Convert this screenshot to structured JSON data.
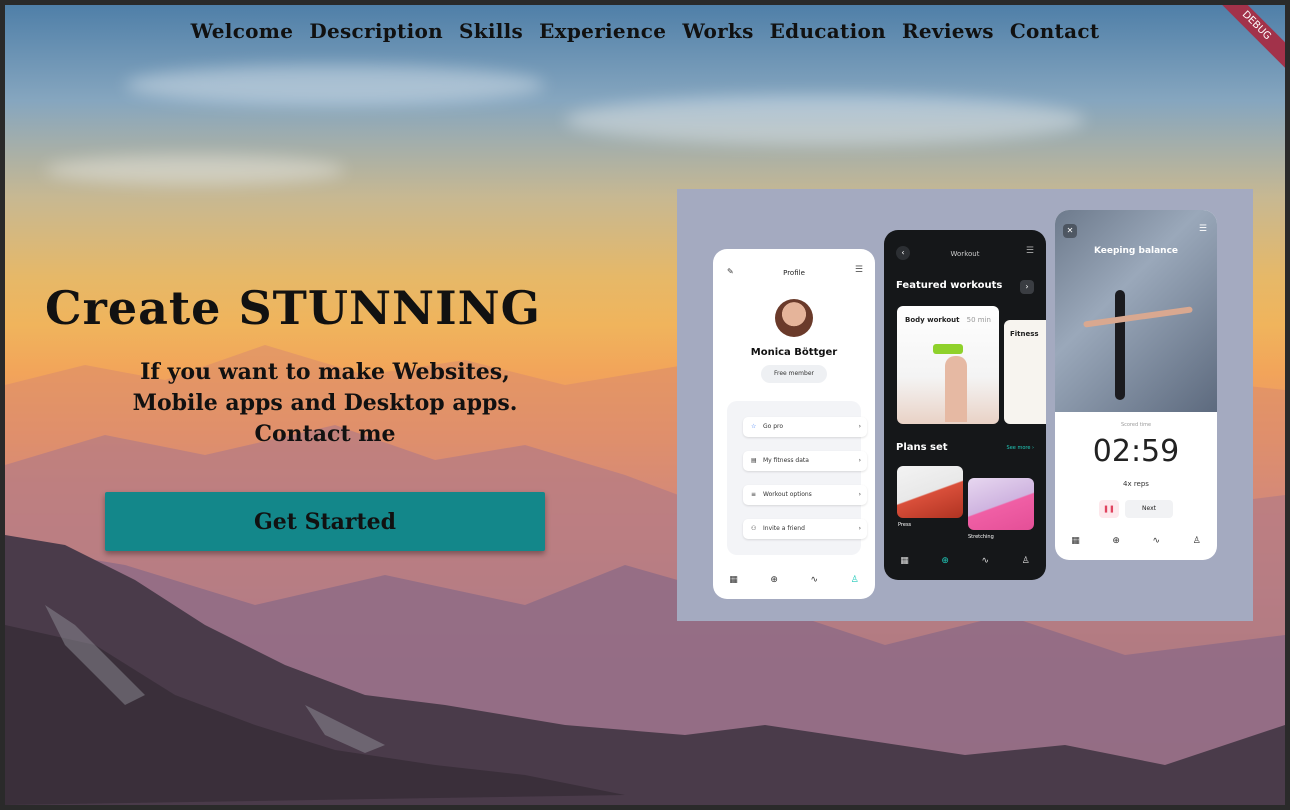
{
  "nav": {
    "items": [
      "Welcome",
      "Description",
      "Skills",
      "Experience",
      "Works",
      "Education",
      "Reviews",
      "Contact"
    ]
  },
  "debug_banner": "DEBUG",
  "hero": {
    "title": "Create STUNNING",
    "subtitle_lines": [
      "If you want to make Websites,",
      "Mobile apps and Desktop apps.",
      "Contact me"
    ],
    "cta_label": "Get Started"
  },
  "showcase": {
    "profile": {
      "header": "Profile",
      "name": "Monica Böttger",
      "badge": "Free member",
      "menu": [
        "Go pro",
        "My fitness data",
        "Workout options",
        "Invite a friend"
      ]
    },
    "workout": {
      "header": "Workout",
      "featured_title": "Featured workouts",
      "card1_title": "Body workout",
      "card1_meta": "50 min",
      "card2_title": "Fitness",
      "plans_title": "Plans set",
      "see_more": "See more ›",
      "plan1": "Press",
      "plan2": "Stretching"
    },
    "timer": {
      "title": "Keeping balance",
      "scored_label": "Scored time",
      "time": "02:59",
      "reps": "4x reps",
      "next_label": "Next"
    }
  },
  "colors": {
    "cta": "#13878a",
    "showcase_bg": "#a4aac0",
    "accent_teal": "#20c9b9"
  }
}
